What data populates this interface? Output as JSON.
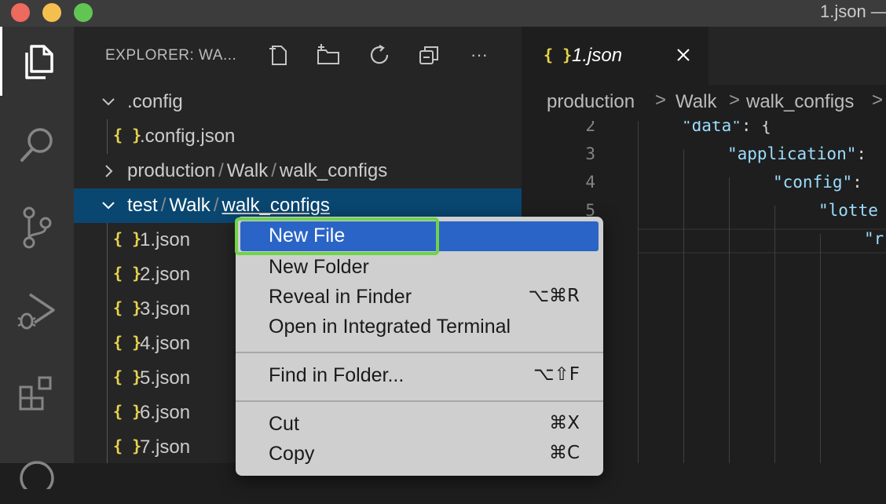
{
  "window": {
    "title": "1.json —"
  },
  "activity_bar": {
    "items": [
      {
        "name": "explorer",
        "icon": "files-icon",
        "active": true
      },
      {
        "name": "search",
        "icon": "search-icon",
        "active": false
      },
      {
        "name": "source-control",
        "icon": "source-control-icon",
        "active": false
      },
      {
        "name": "run-debug",
        "icon": "run-debug-icon",
        "active": false
      },
      {
        "name": "extensions",
        "icon": "extensions-icon",
        "active": false
      },
      {
        "name": "account",
        "icon": "account-icon",
        "active": false
      }
    ]
  },
  "sidebar": {
    "title": "EXPLORER: WA...",
    "actions": [
      "new-file-icon",
      "new-folder-icon",
      "refresh-icon",
      "collapse-all-icon",
      "more-icon"
    ],
    "more_label": "···",
    "tree": {
      "config_folder": ".config",
      "config_file": ".config.json",
      "production": {
        "a": "production",
        "b": "Walk",
        "c": "walk_configs"
      },
      "test": {
        "a": "test",
        "b": "Walk",
        "c": "walk_configs"
      },
      "path_sep": "/",
      "files": [
        "1.json",
        "2.json",
        "3.json",
        "4.json",
        "5.json",
        "6.json",
        "7.json"
      ],
      "json_icon": "{ }"
    }
  },
  "editor": {
    "tab": {
      "icon": "{ }",
      "label": "1.json"
    },
    "breadcrumbs": [
      "production",
      "Walk",
      "walk_configs"
    ],
    "breadcrumb_sep": ">",
    "line_numbers": [
      "2",
      "3",
      "4",
      "5"
    ],
    "code": [
      {
        "key": "\"data\"",
        "rest": ": {"
      },
      {
        "key": "\"application\"",
        "rest": ":"
      },
      {
        "key": "\"config\"",
        "rest": ":"
      },
      {
        "key": "\"lotte",
        "rest": ""
      },
      {
        "key": "\"r",
        "rest": ""
      }
    ]
  },
  "context_menu": {
    "items": [
      {
        "label": "New File",
        "shortcut": ""
      },
      {
        "label": "New Folder",
        "shortcut": ""
      },
      {
        "label": "Reveal in Finder",
        "shortcut": "⌥⌘R"
      },
      {
        "label": "Open in Integrated Terminal",
        "shortcut": ""
      },
      {
        "label": "Find in Folder...",
        "shortcut": "⌥⇧F"
      },
      {
        "label": "Cut",
        "shortcut": "⌘X"
      },
      {
        "label": "Copy",
        "shortcut": "⌘C"
      }
    ],
    "highlighted": "New File"
  },
  "colors": {
    "accent_highlight": "#2a64c6",
    "focus_ring": "#6fd34a",
    "selection": "#094771",
    "json_icon": "#e8d44d"
  }
}
